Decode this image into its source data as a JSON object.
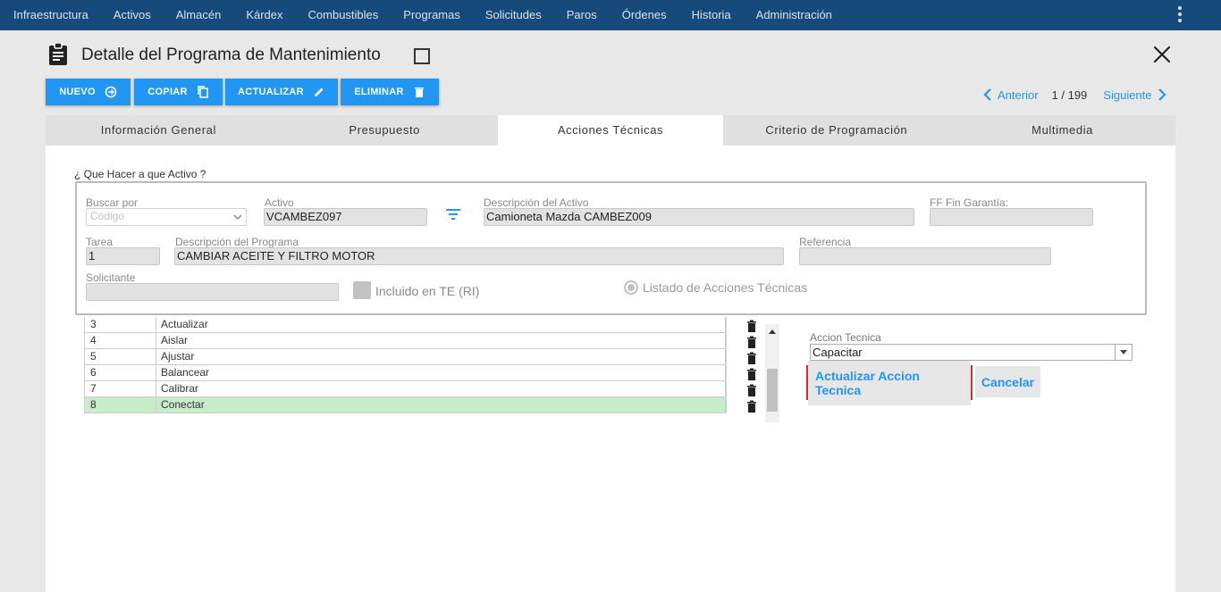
{
  "nav": {
    "items": [
      "Infraestructura",
      "Activos",
      "Almacén",
      "Kárdex",
      "Combustibles",
      "Programas",
      "Solicitudes",
      "Paros",
      "Órdenes",
      "Historia",
      "Administración"
    ]
  },
  "header": {
    "title": "Detalle del Programa de Mantenimiento"
  },
  "toolbar": {
    "nuevo": "NUEVO",
    "copiar": "COPIAR",
    "actualizar": "ACTUALIZAR",
    "eliminar": "ELIMINAR"
  },
  "pager": {
    "prev": "Anterior",
    "count": "1 / 199",
    "next": "Siguiente"
  },
  "tabs": [
    "Información General",
    "Presupuesto",
    "Acciones Técnicas",
    "Criterio de Programación",
    "Multimedia"
  ],
  "active_tab": "Acciones Técnicas",
  "form": {
    "section_label": "¿ Que Hacer a que Activo ?",
    "buscar_por_label": "Buscar por",
    "buscar_por_placeholder": "Código",
    "activo_label": "Activo",
    "activo_value": "VCAMBEZ097",
    "desc_activo_label": "Descripción del Activo",
    "desc_activo_value": "Camioneta Mazda CAMBEZ009",
    "ff_label": "FF Fin Garantía:",
    "ff_value": "",
    "tarea_label": "Tarea",
    "tarea_value": "1",
    "desc_programa_label": "Descripción del Programa",
    "desc_programa_value": "CAMBIAR ACEITE Y FILTRO MOTOR",
    "referencia_label": "Referencia",
    "referencia_value": "",
    "solicitante_label": "Solicitante",
    "solicitante_value": "",
    "incluido_label": "Incluido en TE (RI)",
    "listado_label": "Listado de Acciones Técnicas"
  },
  "grid": {
    "rows": [
      {
        "num": "3",
        "name": "Actualizar"
      },
      {
        "num": "4",
        "name": "Aislar"
      },
      {
        "num": "5",
        "name": "Ajustar"
      },
      {
        "num": "6",
        "name": "Balancear"
      },
      {
        "num": "7",
        "name": "Calibrar"
      },
      {
        "num": "8",
        "name": "Conectar"
      }
    ],
    "selected_row": "8"
  },
  "accion": {
    "label": "Accion Tecnica",
    "value": "Capacitar",
    "update_button": "Actualizar Accion Tecnica",
    "cancel_button": "Cancelar"
  },
  "colors": {
    "nav_bg": "#164a7a",
    "accent": "#2196f3",
    "selected_row": "#c6ecc9",
    "highlight_border": "#d32f2f"
  }
}
